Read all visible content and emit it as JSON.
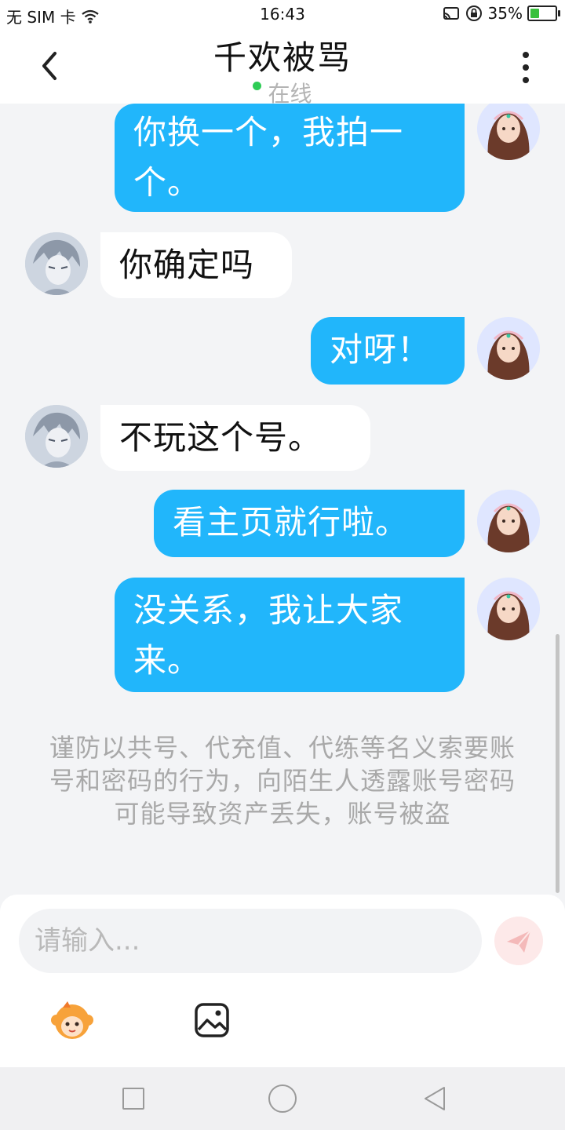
{
  "status_bar": {
    "carrier": "无 SIM 卡",
    "time": "16:43",
    "battery": "35%",
    "battery_level": 0.35,
    "icons": [
      "wifi-icon",
      "cast-icon",
      "rotation-lock-icon",
      "battery-charging-icon"
    ]
  },
  "header": {
    "title": "千欢被骂",
    "status": "在线",
    "status_color": "#2ecc55",
    "icons": [
      "back-icon",
      "more-vertical-icon"
    ]
  },
  "messages": [
    {
      "side": "out",
      "text": "你换一个，我拍一个。"
    },
    {
      "side": "in",
      "text": "你确定吗"
    },
    {
      "side": "out",
      "text": "对呀！"
    },
    {
      "side": "in",
      "text": "不玩这个号。"
    },
    {
      "side": "out",
      "text": "看主页就行啦。"
    },
    {
      "side": "out",
      "text": "没关系，我让大家来。"
    }
  ],
  "notice": "谨防以共号、代充值、代练等名义索要账号和密码的行为，向陌生人透露账号密码可能导致资产丢失，账号被盗",
  "composer": {
    "placeholder": "请输入...",
    "tools": [
      "emoji-mascot-icon",
      "image-icon"
    ],
    "send_icon": "send-icon"
  },
  "colors": {
    "outgoing_bubble": "#21b6fb",
    "incoming_bubble": "#ffffff",
    "background": "#f3f4f6"
  },
  "nav_icons": [
    "recent-apps-icon",
    "home-icon",
    "back-nav-icon"
  ]
}
